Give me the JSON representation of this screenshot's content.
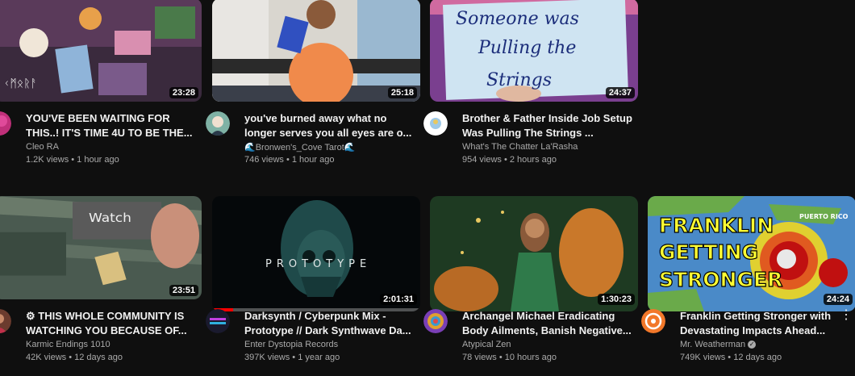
{
  "videos": [
    {
      "title": "YOU'VE BEEN WAITING FOR THIS..! IT'S TIME 4U TO BE THE...",
      "channel": "Cleo RA",
      "stats": "1.2K views • 1 hour ago",
      "duration": "23:28",
      "avatar_color": "#c0307a"
    },
    {
      "title": "you've burned away what no longer serves you all eyes are o...",
      "channel": "🌊Bronwen's_Cove Tarot🌊",
      "stats": "746 views • 1 hour ago",
      "duration": "25:18",
      "avatar_color": "#7fb2a5"
    },
    {
      "title": "Brother & Father Inside Job Setup Was Pulling The Strings ...",
      "channel": "What's The Chatter La'Rasha",
      "stats": "954 views • 2 hours ago",
      "duration": "24:37",
      "avatar_color": "#ffffff",
      "thumb_text": [
        "Someone was",
        "Pulling the",
        "Strings"
      ]
    },
    {
      "title": "⚙ THIS WHOLE COMMUNITY IS WATCHING YOU BECAUSE OF...",
      "channel": "Karmic Endings 1010",
      "stats": "42K views • 12 days ago",
      "duration": "23:51",
      "avatar_color": "#6b3b2e",
      "thumb_text": "Watch"
    },
    {
      "title": "Darksynth / Cyberpunk Mix - Prototype // Dark Synthwave Da...",
      "channel": "Enter Dystopia Records",
      "stats": "397K views • 1 year ago",
      "duration": "2:01:31",
      "avatar_color": "#1a1a2e",
      "thumb_text": "PROTOTYPE",
      "watched_fraction": 0.1
    },
    {
      "title": "Archangel Michael Eradicating Body Ailments, Banish Negative...",
      "channel": "Atypical Zen",
      "stats": "78 views • 10 hours ago",
      "duration": "1:30:23",
      "avatar_color": "#7a3fb5"
    },
    {
      "title": "Franklin Getting Stronger with Devastating Impacts Ahead...",
      "channel": "Mr. Weatherman",
      "stats": "749K views • 12 days ago",
      "duration": "24:24",
      "avatar_color": "#f2782a",
      "thumb_text": [
        "FRANKLIN",
        "GETTING",
        "STRONGER"
      ],
      "map_label": "PUERTO RICO",
      "verified": true
    }
  ]
}
